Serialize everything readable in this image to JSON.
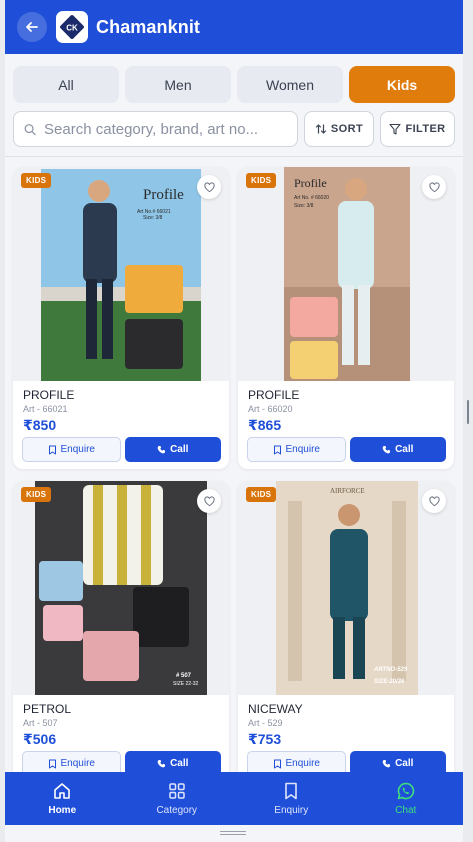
{
  "header": {
    "title": "Chamanknit",
    "back_icon": "arrow-left-icon",
    "logo_text": "CK",
    "colors": {
      "primary": "#1f4fd8",
      "accent": "#e07c0b"
    }
  },
  "tabs": [
    {
      "label": "All",
      "active": false
    },
    {
      "label": "Men",
      "active": false
    },
    {
      "label": "Women",
      "active": false
    },
    {
      "label": "Kids",
      "active": true
    }
  ],
  "search": {
    "placeholder": "Search category, brand, art no...",
    "value": ""
  },
  "toolbar": {
    "sort_label": "SORT",
    "filter_label": "FILTER"
  },
  "products": [
    {
      "badge": "KIDS",
      "brand": "PROFILE",
      "art": "Art - 66021",
      "price": "₹850",
      "enquire_label": "Enquire",
      "call_label": "Call",
      "image_text": "Profile",
      "image_subtext": "Art No.# 66021",
      "image_size": "Size: 3/8"
    },
    {
      "badge": "KIDS",
      "brand": "PROFILE",
      "art": "Art - 66020",
      "price": "₹865",
      "enquire_label": "Enquire",
      "call_label": "Call",
      "image_text": "Profile",
      "image_subtext": "Art No. # 66020",
      "image_size": "Size: 3/8"
    },
    {
      "badge": "KIDS",
      "brand": "PETROL",
      "art": "Art - 507",
      "price": "₹506",
      "enquire_label": "Enquire",
      "call_label": "Call",
      "image_text": "# 507",
      "image_subtext": "SIZE 22-32",
      "image_size": ""
    },
    {
      "badge": "KIDS",
      "brand": "NICEWAY",
      "art": "Art - 529",
      "price": "₹753",
      "enquire_label": "Enquire",
      "call_label": "Call",
      "image_text": "ARTNO-529",
      "image_subtext": "SIZE-20/36",
      "image_size": "AIRFORCE"
    }
  ],
  "bottom_nav": [
    {
      "label": "Home",
      "icon": "home-icon",
      "active": true
    },
    {
      "label": "Category",
      "icon": "grid-icon",
      "active": false
    },
    {
      "label": "Enquiry",
      "icon": "bookmark-icon",
      "active": false
    },
    {
      "label": "Chat",
      "icon": "whatsapp-icon",
      "active": false
    }
  ]
}
